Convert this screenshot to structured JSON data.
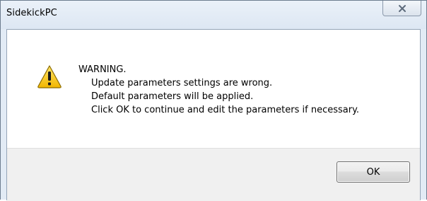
{
  "window": {
    "title": "SidekickPC"
  },
  "dialog": {
    "icon": "warning-icon",
    "heading": "WARNING.",
    "lines": [
      "Update parameters settings are wrong.",
      "Default parameters will be applied.",
      "Click OK to continue and edit the parameters if necessary."
    ]
  },
  "buttons": {
    "ok_label": "OK",
    "close_icon": "close-icon"
  },
  "colors": {
    "warning_fill": "#f7c800",
    "warning_outline": "#6b5200"
  }
}
